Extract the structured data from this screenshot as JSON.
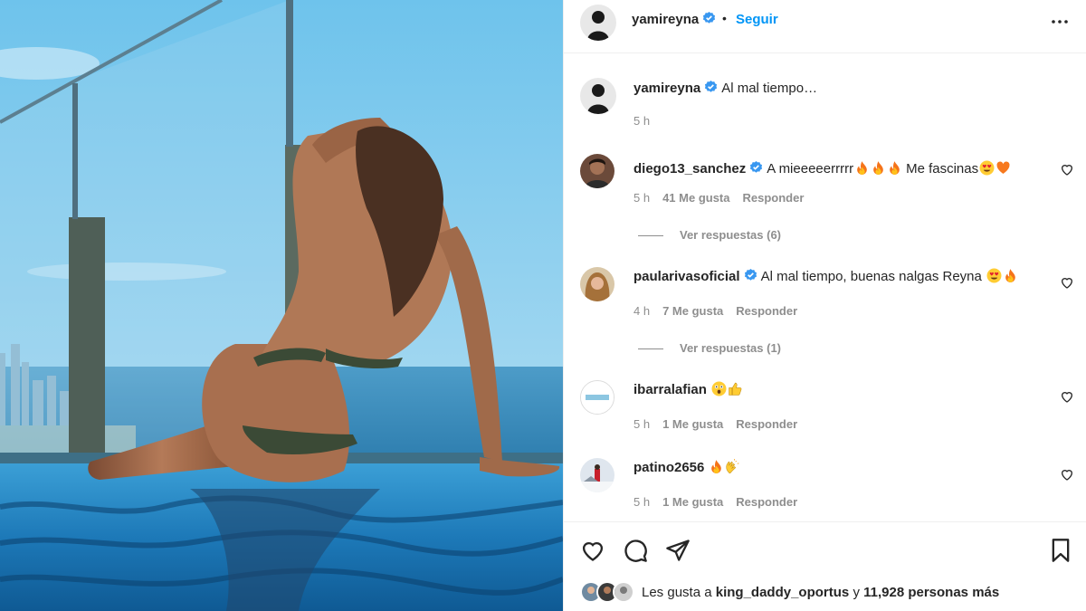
{
  "post": {
    "username": "yamireyna",
    "follow_label": "Seguir",
    "separator": "•",
    "caption": "Al mal tiempo…",
    "time": "5 h"
  },
  "comments": [
    {
      "username": "diego13_sanchez",
      "verified": true,
      "text_a": "A mieeeeerrrrr",
      "emoji_a": [
        "fire",
        "fire",
        "fire"
      ],
      "text_b": "Me fascinas",
      "emoji_b": [
        "heart-eyes",
        "orange-heart"
      ],
      "time": "5 h",
      "likes": "41 Me gusta",
      "reply_label": "Responder",
      "view_replies": "Ver respuestas (6)"
    },
    {
      "username": "paularivasoficial",
      "verified": true,
      "text_a": "Al mal tiempo, buenas nalgas Reyna",
      "emoji_a": [
        "heart-eyes",
        "fire"
      ],
      "time": "4 h",
      "likes": "7 Me gusta",
      "reply_label": "Responder",
      "view_replies": "Ver respuestas (1)"
    },
    {
      "username": "ibarralafian",
      "verified": false,
      "emoji_a": [
        "astonished",
        "thumbs-up"
      ],
      "time": "5 h",
      "likes": "1 Me gusta",
      "reply_label": "Responder"
    },
    {
      "username": "patino2656",
      "verified": false,
      "emoji_a": [
        "fire",
        "clap"
      ],
      "time": "5 h",
      "likes": "1 Me gusta",
      "reply_label": "Responder"
    }
  ],
  "actions": {
    "icons": [
      "heart-icon",
      "comment-icon",
      "share-icon",
      "save-icon"
    ]
  },
  "likes_line": {
    "prefix": "Les gusta a",
    "user": "king_daddy_oportus",
    "middle": "y",
    "count": "11,928 personas más"
  },
  "colors": {
    "link": "#0095f6",
    "verified": "#3897f0",
    "muted": "#8e8e8e",
    "text": "#262626"
  }
}
